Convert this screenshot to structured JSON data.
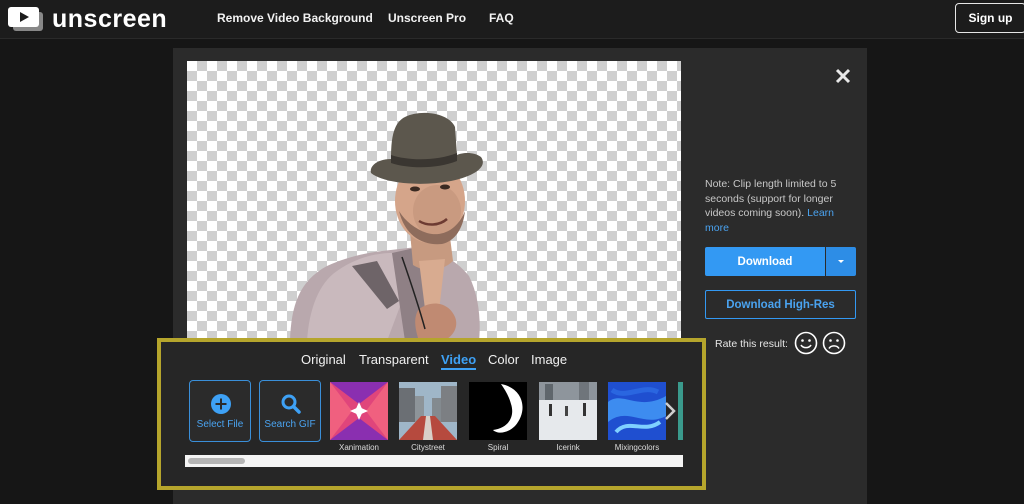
{
  "header": {
    "logo_text": "unscreen",
    "nav": [
      {
        "label": "Remove Video Background"
      },
      {
        "label": "Unscreen Pro"
      },
      {
        "label": "FAQ"
      }
    ],
    "signup_label": "Sign up"
  },
  "editor": {
    "note_text": "Note: Clip length limited to 5 seconds (support for longer videos coming soon).",
    "note_link": "Learn more",
    "download_label": "Download",
    "download_hires_label": "Download High-Res",
    "rate_label": "Rate this result:"
  },
  "background": {
    "tabs": [
      {
        "label": "Original"
      },
      {
        "label": "Transparent"
      },
      {
        "label": "Video"
      },
      {
        "label": "Color"
      },
      {
        "label": "Image"
      }
    ],
    "active_tab": "Video",
    "select_file_label": "Select File",
    "search_gif_label": "Search GIF",
    "thumbnails": [
      {
        "label": "Xanimation"
      },
      {
        "label": "Citystreet"
      },
      {
        "label": "Spiral"
      },
      {
        "label": "Icerink"
      },
      {
        "label": "Mixingcolors"
      }
    ]
  },
  "colors": {
    "accent": "#3399f3",
    "highlight_frame": "#b5a52c",
    "page_bg": "#161616",
    "panel_bg": "#2b2b2b"
  }
}
